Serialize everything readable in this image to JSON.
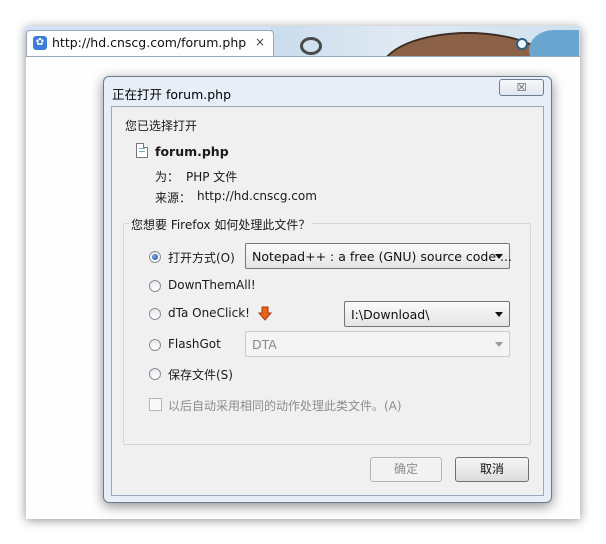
{
  "browser": {
    "tab": {
      "title": "http://hd.cnscg.com/forum.php",
      "close_glyph": "×"
    }
  },
  "dialog": {
    "title": "正在打开 forum.php",
    "close_glyph": "☒",
    "intro": "您已选择打开",
    "file_name": "forum.php",
    "type_label": "为：",
    "type_value": "PHP 文件",
    "source_label": "来源：",
    "source_value": "http://hd.cnscg.com",
    "question": "您想要 Firefox 如何处理此文件？",
    "options": {
      "open_with": {
        "label": "打开方式(O)",
        "selected": true,
        "app": "Notepad++ : a free (GNU) source code ..."
      },
      "downthemall": {
        "label": "DownThemAll!"
      },
      "dta_oneclick": {
        "label": "dTa OneClick!",
        "folder": "I:\\Download\\"
      },
      "flashgot": {
        "label": "FlashGot",
        "value": "DTA"
      },
      "save_file": {
        "label": "保存文件(S)"
      }
    },
    "remember": {
      "label": "以后自动采用相同的动作处理此类文件。(A)",
      "checked": false
    },
    "ok_button": "确定",
    "cancel_button": "取消"
  },
  "colors": {
    "accent": "#1e4f9c",
    "dialog_frame": "#e7eef7",
    "client_bg": "#f0f0f0"
  }
}
